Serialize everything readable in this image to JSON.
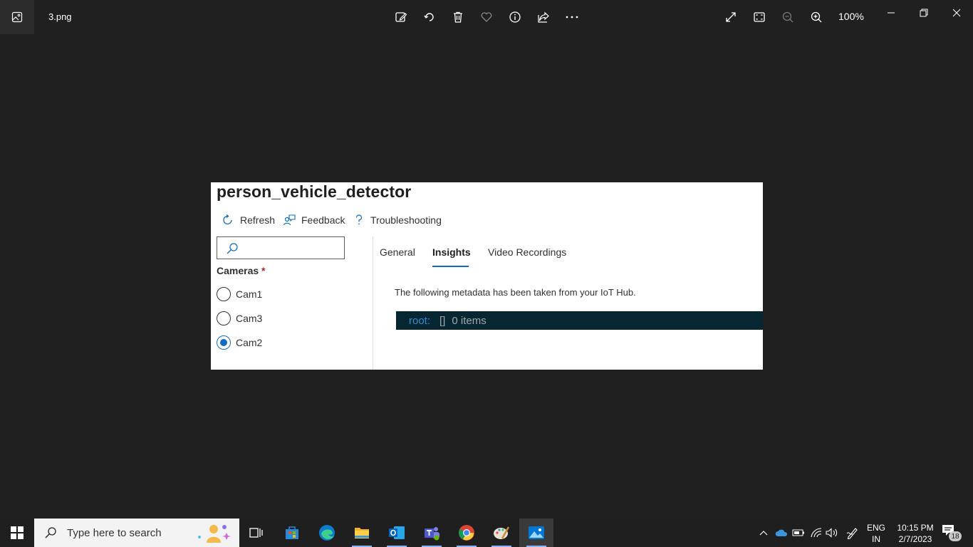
{
  "viewer": {
    "file_name": "3.png",
    "zoom": "100%",
    "toolbar_icons": [
      "edit-image-icon",
      "rotate-icon",
      "delete-icon",
      "favorite-icon",
      "info-icon",
      "share-icon",
      "more-icon"
    ],
    "right_icons": [
      "full-screen-icon",
      "fit-window-icon",
      "zoom-out-icon",
      "zoom-in-icon"
    ]
  },
  "screenshot": {
    "title": "person_vehicle_detector",
    "commands": [
      {
        "label": "Refresh",
        "icon": "refresh-icon"
      },
      {
        "label": "Feedback",
        "icon": "feedback-icon"
      },
      {
        "label": "Troubleshooting",
        "icon": "question-icon"
      }
    ],
    "search_placeholder": "",
    "cameras_label": "Cameras",
    "required_mark": "*",
    "cameras": [
      {
        "label": "Cam1",
        "selected": false
      },
      {
        "label": "Cam3",
        "selected": false
      },
      {
        "label": "Cam2",
        "selected": true
      }
    ],
    "tabs": [
      {
        "label": "General",
        "active": false
      },
      {
        "label": "Insights",
        "active": true
      },
      {
        "label": "Video Recordings",
        "active": false
      }
    ],
    "metadata_text": "The following metadata has been taken from your IoT Hub.",
    "json_view": {
      "key": "root:",
      "bracket": "[]",
      "count": "0 items"
    },
    "colors": {
      "accent": "#0f6cbd",
      "json_bg": "#062731",
      "json_key": "#2e8fd8"
    }
  },
  "taskbar": {
    "search_placeholder": "Type here to search",
    "apps": [
      "task-view-icon",
      "store-icon",
      "edge-icon",
      "file-explorer-icon",
      "outlook-icon",
      "teams-icon",
      "chrome-icon",
      "paint-icon",
      "photos-icon"
    ],
    "lang_line1": "ENG",
    "lang_line2": "IN",
    "time": "10:15 PM",
    "date": "2/7/2023",
    "notification_count": "18"
  }
}
